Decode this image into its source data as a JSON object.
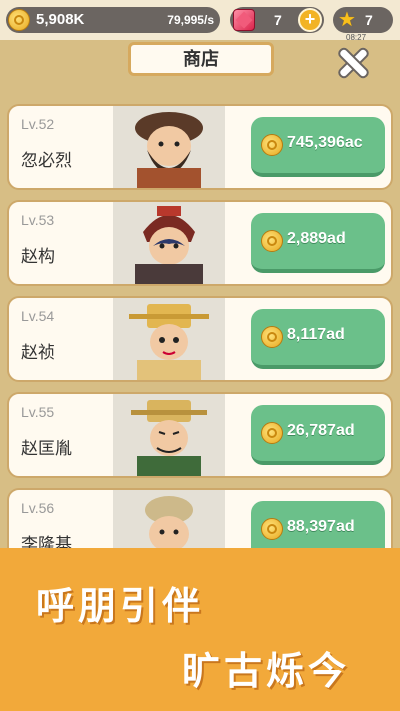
{
  "top_bar": {
    "coins": "5,908K",
    "coin_rate": "79,995/s",
    "gems": "7",
    "stars": "7",
    "timer": "08:27"
  },
  "shop": {
    "title": "商店"
  },
  "items": [
    {
      "level": "Lv.52",
      "name": "忽必烈",
      "price": "745,396ac"
    },
    {
      "level": "Lv.53",
      "name": "赵构",
      "price": "2,889ad"
    },
    {
      "level": "Lv.54",
      "name": "赵祯",
      "price": "8,117ad"
    },
    {
      "level": "Lv.55",
      "name": "赵匡胤",
      "price": "26,787ad"
    },
    {
      "level": "Lv.56",
      "name": "李隆基",
      "price": "88,397ad"
    }
  ],
  "banner": {
    "line1": "呼朋引伴",
    "line2": "旷古烁今"
  },
  "colors": {
    "buy_button": "#6bc08a",
    "banner": "#f2a93a"
  }
}
